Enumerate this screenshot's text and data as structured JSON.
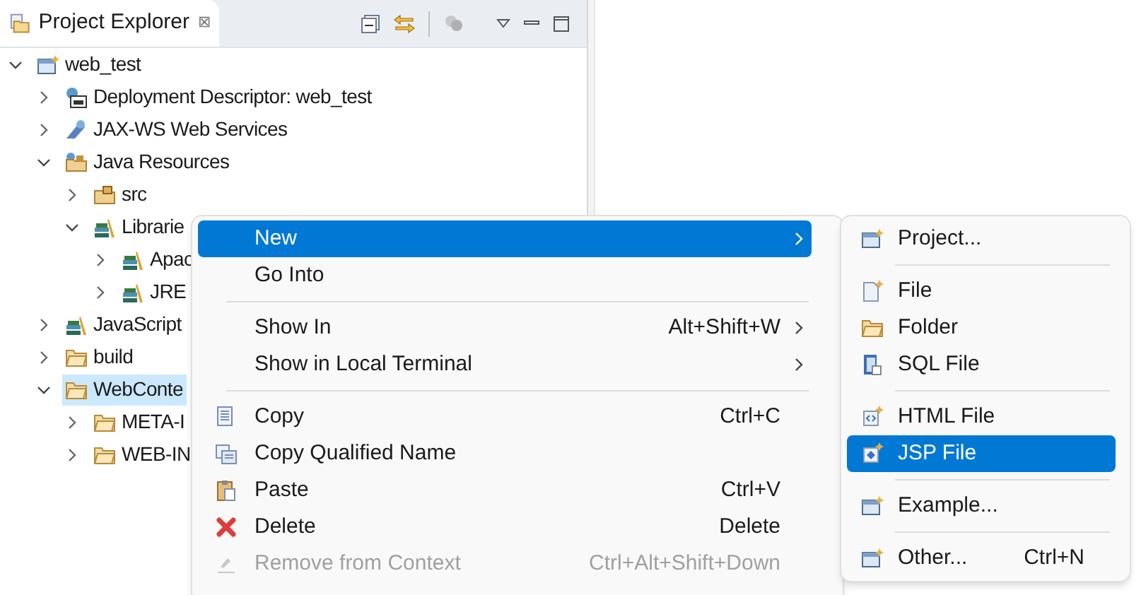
{
  "view": {
    "title": "Project Explorer",
    "close": "⊠"
  },
  "tree": [
    {
      "label": "web_test",
      "expanded": true,
      "selected": false,
      "kind": "project",
      "children": [
        {
          "label": "Deployment Descriptor: web_test",
          "expanded": false,
          "selected": false,
          "kind": "descriptor"
        },
        {
          "label": "JAX-WS Web Services",
          "expanded": false,
          "selected": false,
          "kind": "webservice"
        },
        {
          "label": "Java Resources",
          "expanded": true,
          "selected": false,
          "kind": "resources",
          "children": [
            {
              "label": "src",
              "expanded": false,
              "selected": false,
              "kind": "package"
            },
            {
              "label": "Librarie",
              "expanded": true,
              "selected": false,
              "kind": "library",
              "children": [
                {
                  "label": "Apac",
                  "expanded": false,
                  "selected": false,
                  "kind": "library"
                },
                {
                  "label": "JRE",
                  "expanded": false,
                  "selected": false,
                  "kind": "library"
                }
              ]
            }
          ]
        },
        {
          "label": "JavaScript",
          "expanded": false,
          "selected": false,
          "kind": "library"
        },
        {
          "label": "build",
          "expanded": false,
          "selected": false,
          "kind": "folder"
        },
        {
          "label": "WebConte",
          "expanded": true,
          "selected": true,
          "kind": "folder",
          "children": [
            {
              "label": "META-I",
              "expanded": false,
              "selected": false,
              "kind": "folder"
            },
            {
              "label": "WEB-IN",
              "expanded": false,
              "selected": false,
              "kind": "folder"
            }
          ]
        }
      ]
    }
  ],
  "context_menu": [
    {
      "kind": "item",
      "label": "New",
      "submenu": true,
      "selected": true,
      "disabled": false
    },
    {
      "kind": "item",
      "label": "Go Into",
      "submenu": false,
      "selected": false,
      "disabled": false
    },
    {
      "kind": "separator"
    },
    {
      "kind": "item",
      "label": "Show In",
      "shortcut": "Alt+Shift+W",
      "submenu": true,
      "selected": false,
      "disabled": false
    },
    {
      "kind": "item",
      "label": "Show in Local Terminal",
      "submenu": true,
      "selected": false,
      "disabled": false
    },
    {
      "kind": "separator"
    },
    {
      "kind": "item",
      "label": "Copy",
      "shortcut": "Ctrl+C",
      "submenu": false,
      "selected": false,
      "disabled": false
    },
    {
      "kind": "item",
      "label": "Copy Qualified Name",
      "submenu": false,
      "selected": false,
      "disabled": false
    },
    {
      "kind": "item",
      "label": "Paste",
      "shortcut": "Ctrl+V",
      "submenu": false,
      "selected": false,
      "disabled": false
    },
    {
      "kind": "item",
      "label": "Delete",
      "shortcut": "Delete",
      "submenu": false,
      "selected": false,
      "disabled": false
    },
    {
      "kind": "item",
      "label": "Remove from Context",
      "shortcut": "Ctrl+Alt+Shift+Down",
      "submenu": false,
      "selected": false,
      "disabled": true
    }
  ],
  "submenu": [
    {
      "kind": "item",
      "label": "Project...",
      "selected": false
    },
    {
      "kind": "separator"
    },
    {
      "kind": "item",
      "label": "File",
      "selected": false
    },
    {
      "kind": "item",
      "label": "Folder",
      "selected": false
    },
    {
      "kind": "item",
      "label": "SQL File",
      "selected": false
    },
    {
      "kind": "separator"
    },
    {
      "kind": "item",
      "label": "HTML File",
      "selected": false
    },
    {
      "kind": "item",
      "label": "JSP File",
      "selected": true
    },
    {
      "kind": "separator"
    },
    {
      "kind": "item",
      "label": "Example...",
      "selected": false
    },
    {
      "kind": "separator"
    },
    {
      "kind": "item",
      "label": "Other...",
      "shortcut": "Ctrl+N",
      "selected": false
    }
  ]
}
